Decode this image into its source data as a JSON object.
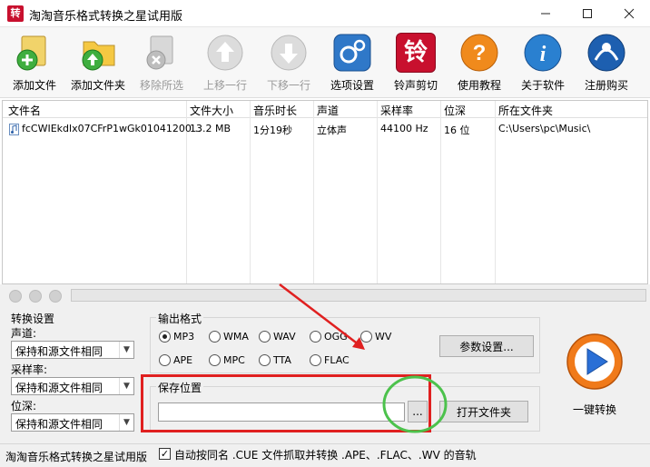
{
  "window": {
    "title": "淘淘音乐格式转换之星试用版",
    "icon_text": "转",
    "min_icon": "minimize-icon",
    "max_icon": "maximize-icon",
    "close_icon": "close-icon"
  },
  "toolbar": {
    "items": [
      {
        "label": "添加文件",
        "icon": "add-file-icon",
        "enabled": true
      },
      {
        "label": "添加文件夹",
        "icon": "add-folder-icon",
        "enabled": true
      },
      {
        "label": "移除所选",
        "icon": "remove-icon",
        "enabled": false
      },
      {
        "label": "上移一行",
        "icon": "move-up-icon",
        "enabled": false
      },
      {
        "label": "下移一行",
        "icon": "move-down-icon",
        "enabled": false
      },
      {
        "label": "选项设置",
        "icon": "settings-icon",
        "enabled": true
      },
      {
        "label": "铃声剪切",
        "icon": "ringtone-cut-icon",
        "enabled": true
      },
      {
        "label": "使用教程",
        "icon": "help-icon",
        "enabled": true
      },
      {
        "label": "关于软件",
        "icon": "info-icon",
        "enabled": true
      },
      {
        "label": "注册购买",
        "icon": "register-icon",
        "enabled": true
      }
    ],
    "ringtone_glyph": "铃"
  },
  "table": {
    "columns": [
      "文件名",
      "文件大小",
      "音乐时长",
      "声道",
      "采样率",
      "位深",
      "所在文件夹"
    ],
    "rows": [
      {
        "name": "fcCWIEkdlx07CFrP1wGk01041200...",
        "size": "13.2 MB",
        "duration": "1分19秒",
        "channel": "立体声",
        "sample_rate": "44100 Hz",
        "bit_depth": "16 位",
        "folder": "C:\\Users\\pc\\Music\\"
      }
    ]
  },
  "conversion_settings": {
    "title": "转换设置",
    "channel_label": "声道:",
    "channel_value": "保持和源文件相同",
    "sample_rate_label": "采样率:",
    "sample_rate_value": "保持和源文件相同",
    "bit_depth_label": "位深:",
    "bit_depth_value": "保持和源文件相同"
  },
  "output_format": {
    "title": "输出格式",
    "options": [
      "MP3",
      "WMA",
      "WAV",
      "OGG",
      "WV",
      "APE",
      "MPC",
      "TTA",
      "FLAC"
    ],
    "selected": "MP3",
    "params_button": "参数设置..."
  },
  "save_location": {
    "title": "保存位置",
    "path": "",
    "browse_button": "...",
    "open_folder_button": "打开文件夹"
  },
  "convert": {
    "label": "一键转换"
  },
  "statusbar": {
    "app_name": "淘淘音乐格式转换之星试用版",
    "auto_cue_checked": true,
    "auto_cue_label": "自动按同名 .CUE 文件抓取并转换 .APE、.FLAC、.WV 的音轨"
  },
  "colors": {
    "annotation_red": "#e02020",
    "annotation_green": "#4cc24c",
    "convert_orange": "#f07a1a",
    "convert_blue": "#2a6fd6"
  }
}
